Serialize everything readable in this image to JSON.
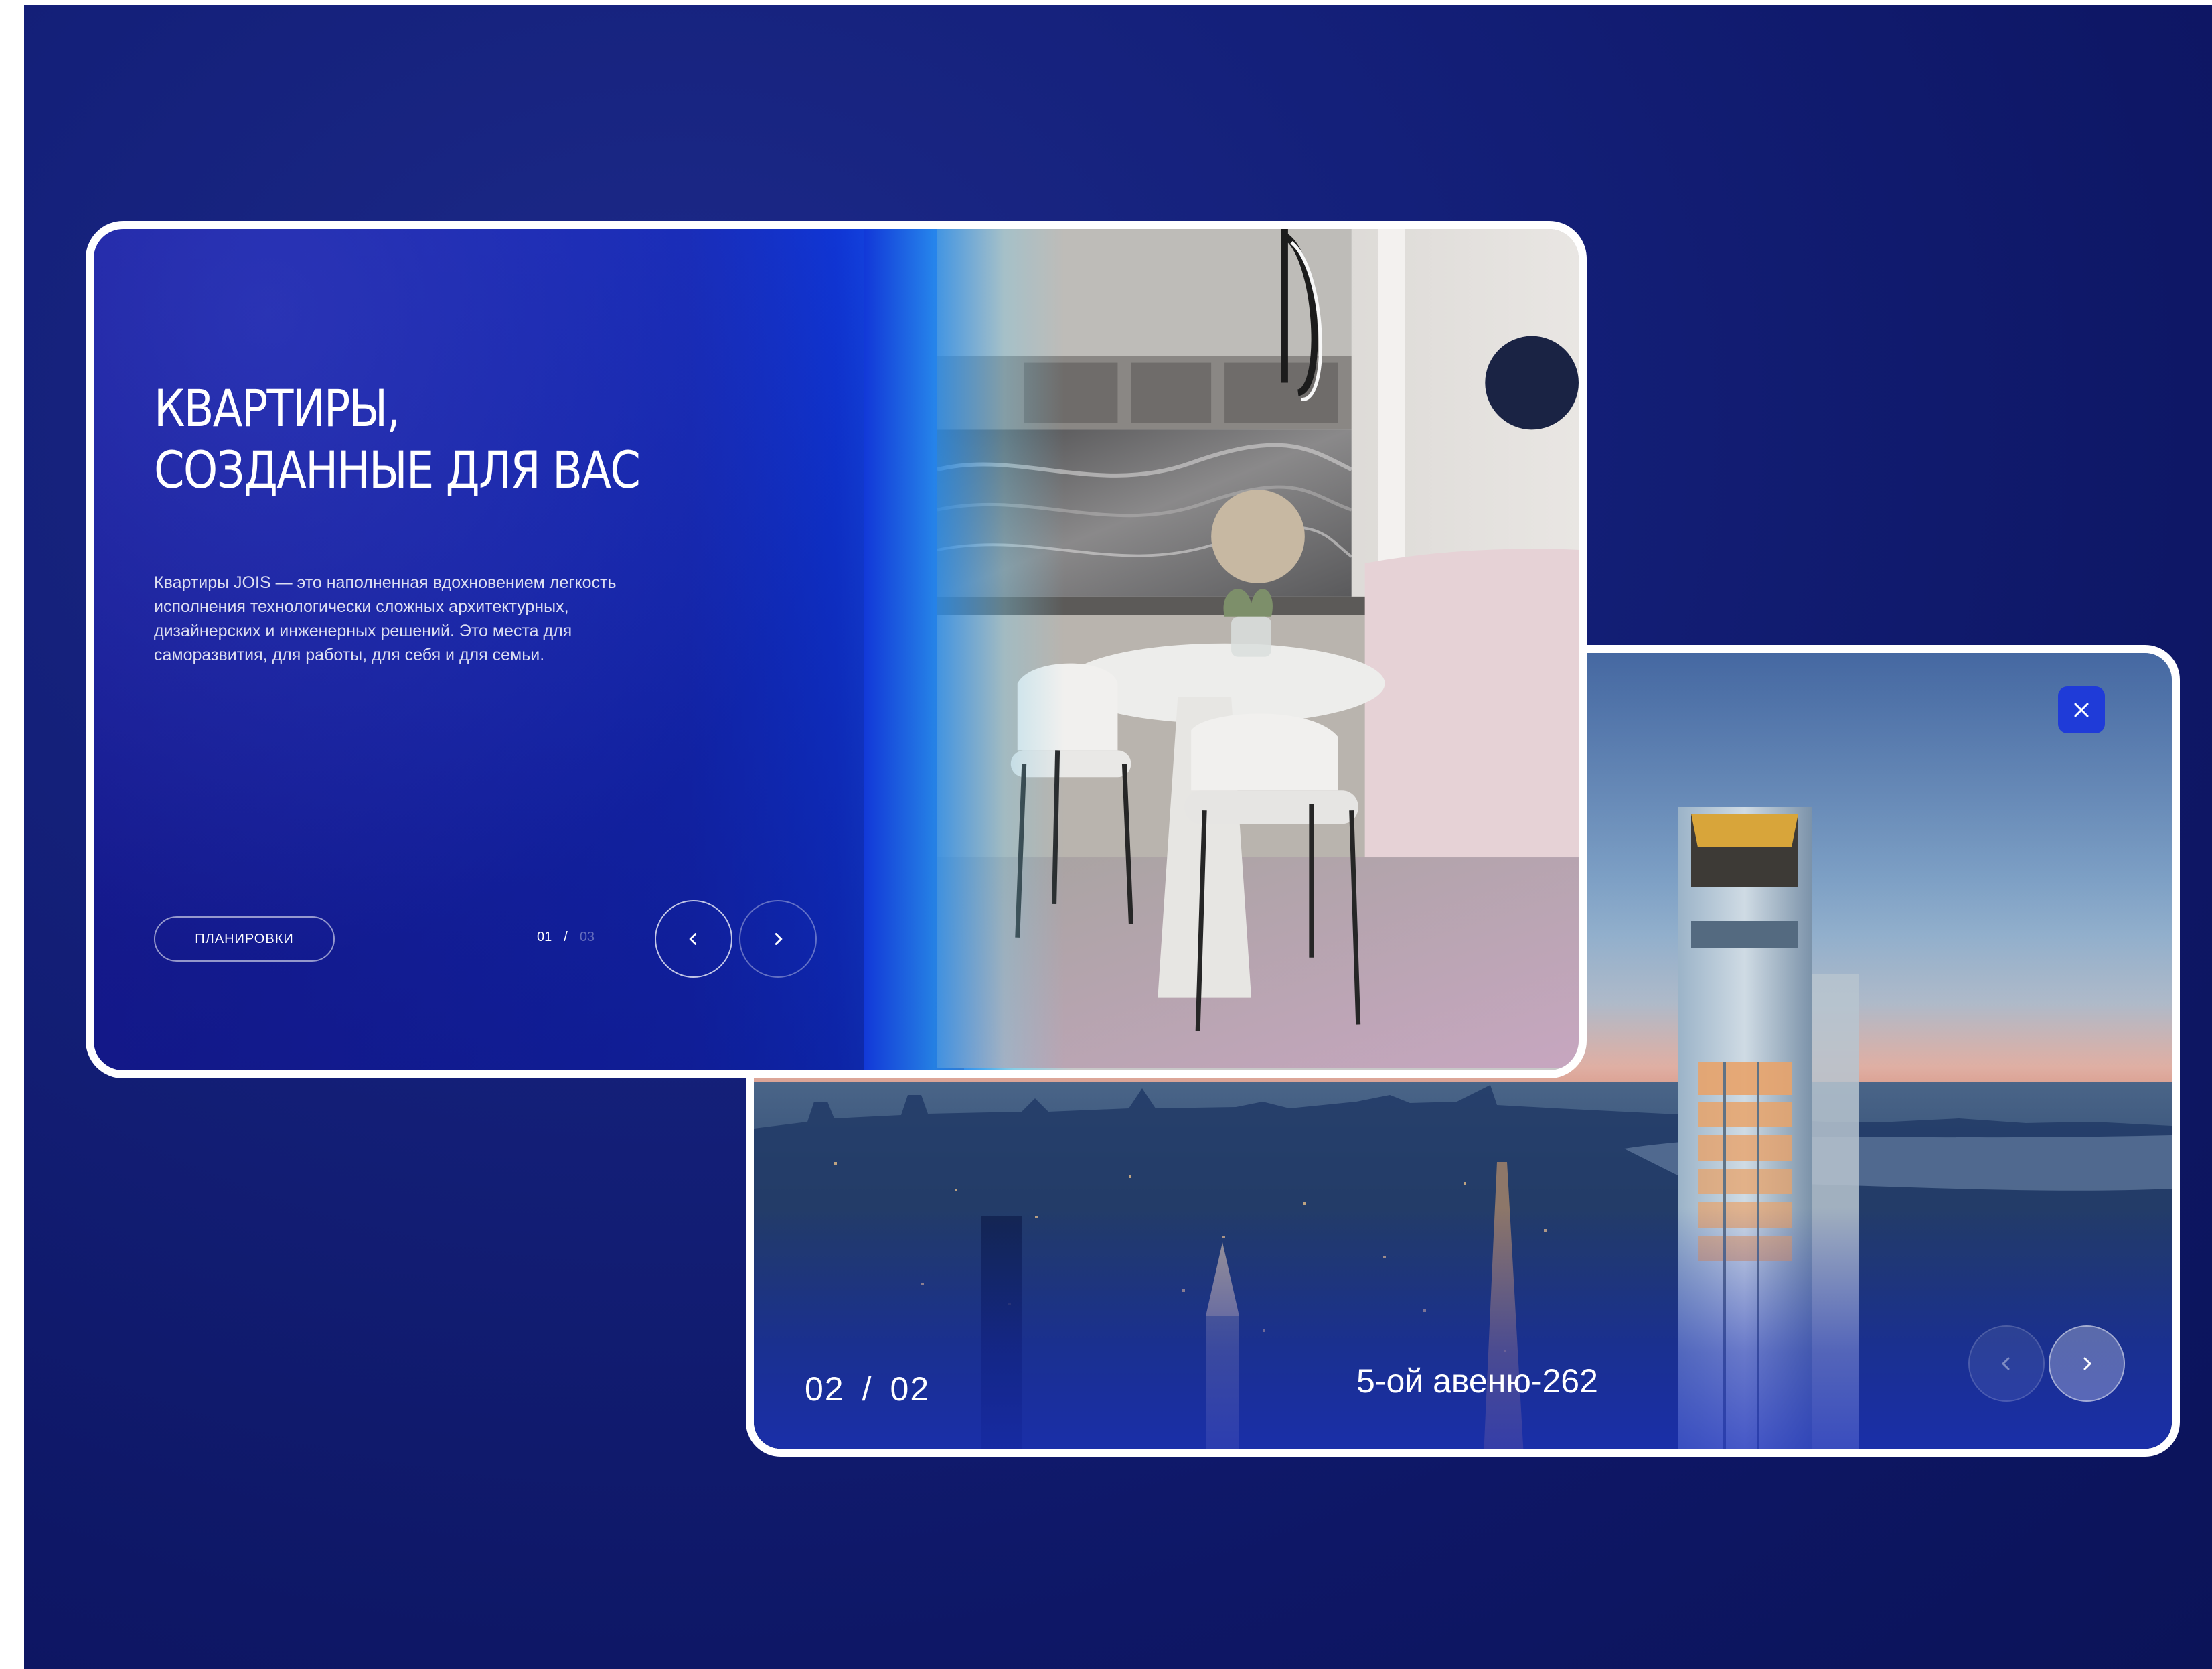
{
  "slide_main": {
    "headline_line1": "КВАРТИРЫ,",
    "headline_line2": "СОЗДАННЫЕ ДЛЯ ВАС",
    "description": "Квартиры JOIS — это наполненная вдохновением легкость исполнения технологически сложных архитектурных, дизайнерских и инженерных решений. Это места для саморазвития, для работы, для себя и для семьи.",
    "plans_button_label": "ПЛАНИРОВКИ",
    "counter_current": "01",
    "counter_separator": "/",
    "counter_total": "03",
    "prev_icon": "chevron-left-icon",
    "next_icon": "chevron-right-icon"
  },
  "slide_city": {
    "counter_current": "02",
    "counter_separator": "/",
    "counter_total": "02",
    "title": "5-ой авеню-262",
    "close_icon": "close-icon",
    "prev_icon": "chevron-left-icon",
    "next_icon": "chevron-right-icon"
  },
  "colors": {
    "background": "#121d76",
    "accent_blue": "#1f3bd8",
    "text": "#ffffff"
  }
}
